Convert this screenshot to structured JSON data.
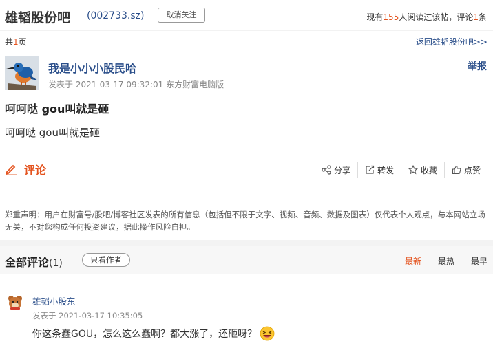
{
  "header": {
    "bar_name": "雄韬股份吧",
    "stock_code": "(002733.sz)",
    "unfollow_label": "取消关注",
    "stats_prefix": "现有",
    "read_count": "155",
    "stats_middle": "人阅读过该帖，评论",
    "comment_count": "1",
    "stats_suffix": "条"
  },
  "pager": {
    "prefix": "共",
    "pages": "1",
    "suffix": "页",
    "back_link": "返回雄韬股份吧>>"
  },
  "post": {
    "author": "我是小小小股民哈",
    "report_label": "举报",
    "meta": "发表于 2021-03-17 09:32:01 东方财富电脑版",
    "title": "呵呵哒 gou叫就是砸",
    "body": "呵呵哒 gou叫就是砸"
  },
  "actions": {
    "comment_label": "评论",
    "share": "分享",
    "repost": "转发",
    "favorite": "收藏",
    "like": "点赞"
  },
  "disclaimer": "郑重声明：用户在财富号/股吧/博客社区发表的所有信息（包括但不限于文字、视频、音频、数据及图表）仅代表个人观点，与本网站立场无关，不对您构成任何投资建议，据此操作风险自担。",
  "comments": {
    "title": "全部评论",
    "count": "(1)",
    "only_author": "只看作者",
    "sort": [
      "最新",
      "最热",
      "最早"
    ],
    "items": [
      {
        "user": "雄韬小股东",
        "meta": "发表于 2021-03-17 10:35:05",
        "text": "你这条蠢GOU，怎么这么蠢啊？都大涨了，还砸呀？"
      }
    ]
  },
  "colors": {
    "accent": "#e4531e",
    "link": "#2a4e8a"
  }
}
